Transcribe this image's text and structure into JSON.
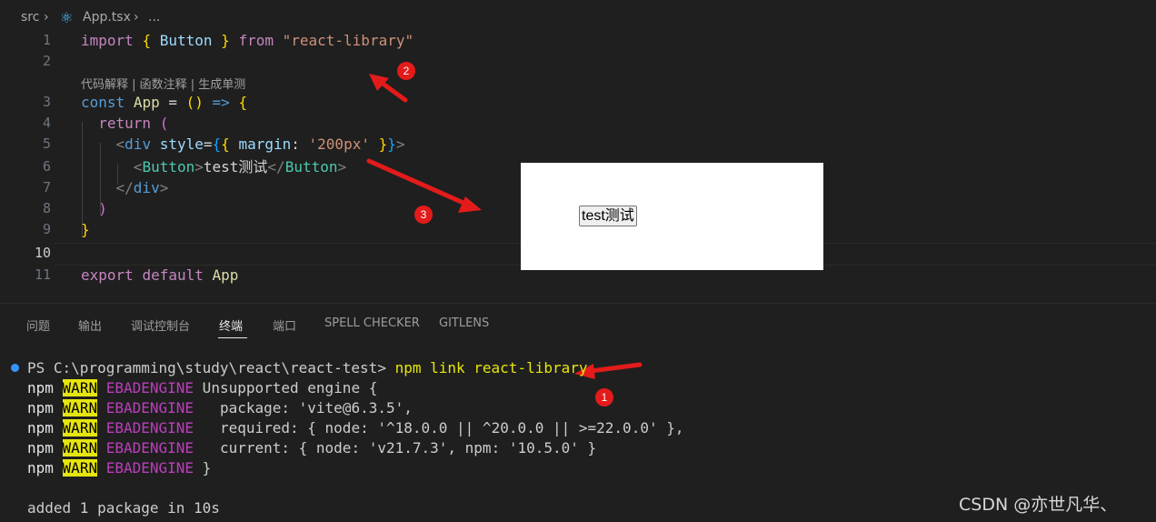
{
  "breadcrumb": {
    "folder": "src",
    "chevron": "›",
    "file_icon": "react-icon",
    "file": "App.tsx",
    "more": "..."
  },
  "editor": {
    "line_numbers": [
      "1",
      "2",
      "3",
      "4",
      "5",
      "6",
      "7",
      "8",
      "9",
      "10",
      "11"
    ],
    "active_line": "10",
    "code_lens": "代码解释 | 函数注释 | 生成单测",
    "tokens": {
      "import": "import",
      "lbrace": "{",
      "Button": "Button",
      "rbrace": "}",
      "from": "from",
      "module": "\"react-library\"",
      "const": "const",
      "App": "App",
      "eq": "=",
      "parens": "()",
      "arrow": "=>",
      "open_brace": "{",
      "return": "return",
      "lparen": "(",
      "div_open_lt": "<",
      "div": "div",
      "style": "style",
      "style_eq": "=",
      "style_lb": "{",
      "style_lb2": "{",
      "margin": "margin",
      "colon": ":",
      "margin_val": "'200px'",
      "style_rb2": "}",
      "style_rb": "}",
      "div_open_gt": ">",
      "btn_lt": "<",
      "btn_tag": "Button",
      "btn_gt": ">",
      "btn_text": "test测试",
      "btn_close_lt": "</",
      "btn_close_tag": "Button",
      "btn_close_gt": ">",
      "div_close_lt": "</",
      "div_close_tag": "div",
      "div_close_gt": ">",
      "rparen": ")",
      "close_brace": "}",
      "export": "export",
      "default": "default",
      "App_export": "App"
    }
  },
  "preview": {
    "button_label": "test测试"
  },
  "annotations": {
    "badge1": "1",
    "badge2": "2",
    "badge3": "3"
  },
  "panel": {
    "tabs": [
      "问题",
      "输出",
      "调试控制台",
      "终端",
      "端口",
      "SPELL CHECKER",
      "GITLENS"
    ],
    "active_tab": "终端"
  },
  "terminal": {
    "prompt": "PS C:\\programming\\study\\react\\react-test> ",
    "command": "npm link react-library",
    "npm": "npm",
    "warn": "WARN",
    "eb": "EBADENGINE",
    "lines": [
      " Unsupported engine {",
      "   package: 'vite@6.3.5',",
      "   required: { node: '^18.0.0 || ^20.0.0 || >=22.0.0' },",
      "   current: { node: 'v21.7.3', npm: '10.5.0' }",
      " }"
    ],
    "result": "added 1 package in 10s"
  },
  "watermark": "CSDN @亦世凡华、",
  "colors": {
    "background": "#1f1f1f",
    "annotation_red": "#e31b1b",
    "warn_bg": "#e5e510"
  }
}
